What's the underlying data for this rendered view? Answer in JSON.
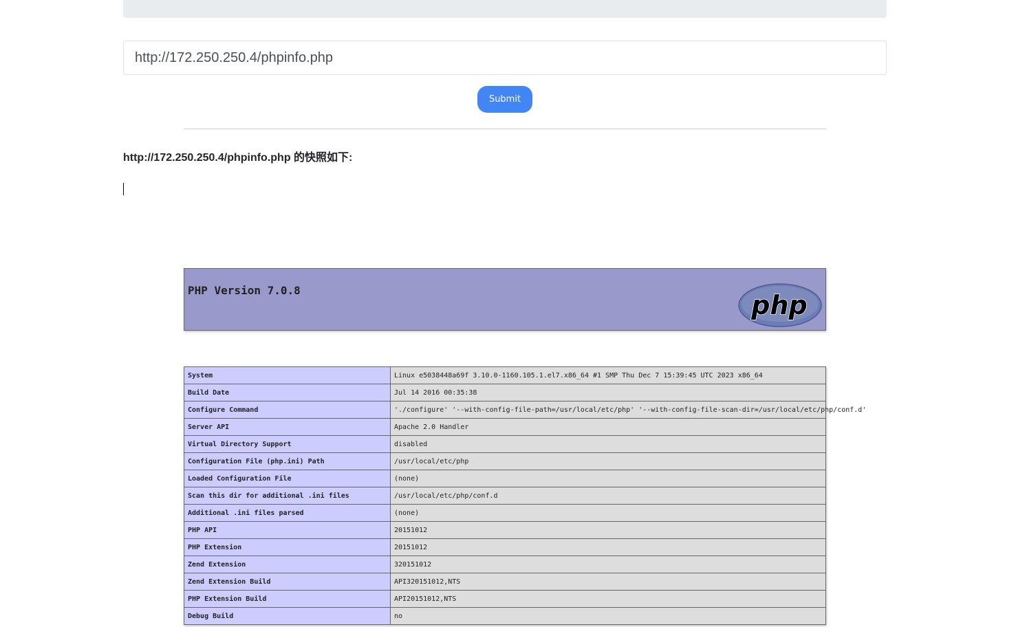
{
  "form": {
    "url_value": "http://172.250.250.4/phpinfo.php",
    "submit_label": "Submit"
  },
  "snapshot": {
    "title": "http://172.250.250.4/phpinfo.php 的快照如下:"
  },
  "phpinfo": {
    "version_title": "PHP Version 7.0.8",
    "logo_text": "php",
    "rows": [
      {
        "key": "System",
        "value": "Linux e5038448a69f 3.10.0-1160.105.1.el7.x86_64 #1 SMP Thu Dec 7 15:39:45 UTC 2023 x86_64"
      },
      {
        "key": "Build Date",
        "value": "Jul 14 2016 00:35:38"
      },
      {
        "key": "Configure Command",
        "value": " './configure'  '--with-config-file-path=/usr/local/etc/php' '--with-config-file-scan-dir=/usr/local/etc/php/conf.d'"
      },
      {
        "key": "Server API",
        "value": "Apache 2.0 Handler"
      },
      {
        "key": "Virtual Directory Support",
        "value": "disabled"
      },
      {
        "key": "Configuration File (php.ini) Path",
        "value": "/usr/local/etc/php"
      },
      {
        "key": "Loaded Configuration File",
        "value": "(none)"
      },
      {
        "key": "Scan this dir for additional .ini files",
        "value": "/usr/local/etc/php/conf.d"
      },
      {
        "key": "Additional .ini files parsed",
        "value": "(none)"
      },
      {
        "key": "PHP API",
        "value": "20151012"
      },
      {
        "key": "PHP Extension",
        "value": "20151012"
      },
      {
        "key": "Zend Extension",
        "value": "320151012"
      },
      {
        "key": "Zend Extension Build",
        "value": "API320151012,NTS"
      },
      {
        "key": "PHP Extension Build",
        "value": "API20151012,NTS"
      },
      {
        "key": "Debug Build",
        "value": "no"
      }
    ]
  },
  "colors": {
    "header_bg": "#9999cc",
    "key_cell_bg": "#ccccff",
    "value_cell_bg": "#dddddd",
    "submit_bg": "#4285f4"
  }
}
